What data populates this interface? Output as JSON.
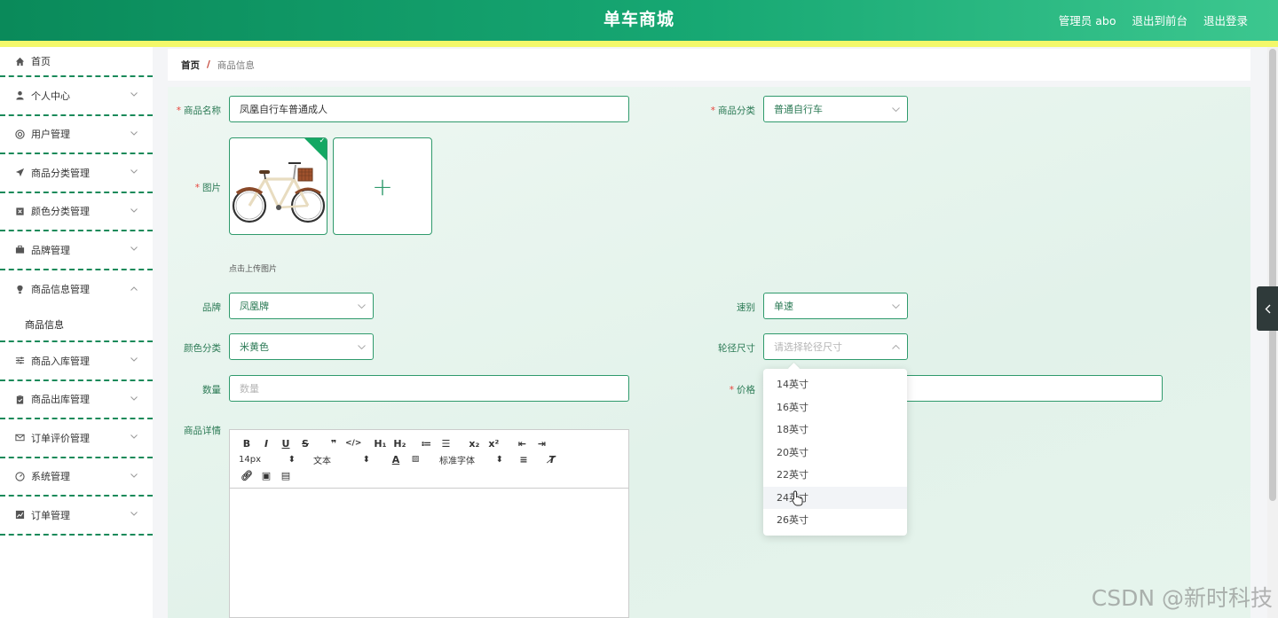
{
  "header": {
    "title": "单车商城",
    "links": [
      "管理员 abo",
      "退出到前台",
      "退出登录"
    ]
  },
  "sidebar": {
    "items": [
      {
        "label": "首页",
        "icon": "home-icon"
      },
      {
        "label": "个人中心",
        "icon": "user-icon"
      },
      {
        "label": "用户管理",
        "icon": "users-circle-icon"
      },
      {
        "label": "商品分类管理",
        "icon": "send-icon"
      },
      {
        "label": "颜色分类管理",
        "icon": "box-x-icon"
      },
      {
        "label": "品牌管理",
        "icon": "briefcase-icon"
      },
      {
        "label": "商品信息管理",
        "icon": "bulb-icon",
        "expanded": true
      },
      {
        "label": "商品信息",
        "sub": true
      },
      {
        "label": "商品入库管理",
        "icon": "sliders-icon"
      },
      {
        "label": "商品出库管理",
        "icon": "clipboard-icon"
      },
      {
        "label": "订单评价管理",
        "icon": "mail-icon"
      },
      {
        "label": "系统管理",
        "icon": "dashboard-icon"
      },
      {
        "label": "订单管理",
        "icon": "chart-icon"
      }
    ]
  },
  "breadcrumb": {
    "home": "首页",
    "sep": "/",
    "current": "商品信息"
  },
  "form": {
    "name_label": "商品名称",
    "name_value": "凤凰自行车普通成人",
    "category_label": "商品分类",
    "category_value": "普通自行车",
    "image_label": "图片",
    "upload_hint": "点击上传图片",
    "upload_plus": "+",
    "brand_label": "品牌",
    "brand_value": "凤凰牌",
    "speed_label": "速别",
    "speed_value": "单速",
    "color_label": "颜色分类",
    "color_value": "米黄色",
    "wheel_label": "轮径尺寸",
    "wheel_placeholder": "请选择轮径尺寸",
    "qty_label": "数量",
    "qty_placeholder": "数量",
    "price_label": "价格",
    "detail_label": "商品详情"
  },
  "editor": {
    "row1": [
      "B",
      "I",
      "U",
      "S",
      "❞",
      "</>",
      "H₁",
      "H₂",
      "≔",
      "☰",
      "x₂",
      "x²",
      "⇤",
      "⇥"
    ],
    "size": "14px",
    "format": "文本",
    "font": "标准字体"
  },
  "dropdown": {
    "options": [
      "14英寸",
      "16英寸",
      "18英寸",
      "20英寸",
      "22英寸",
      "24英寸",
      "26英寸"
    ],
    "hovered_index": 5
  },
  "watermark": "CSDN @新时科技",
  "colors": {
    "primary": "#13935f",
    "accent": "#f3f86a",
    "required": "#e8433a"
  }
}
